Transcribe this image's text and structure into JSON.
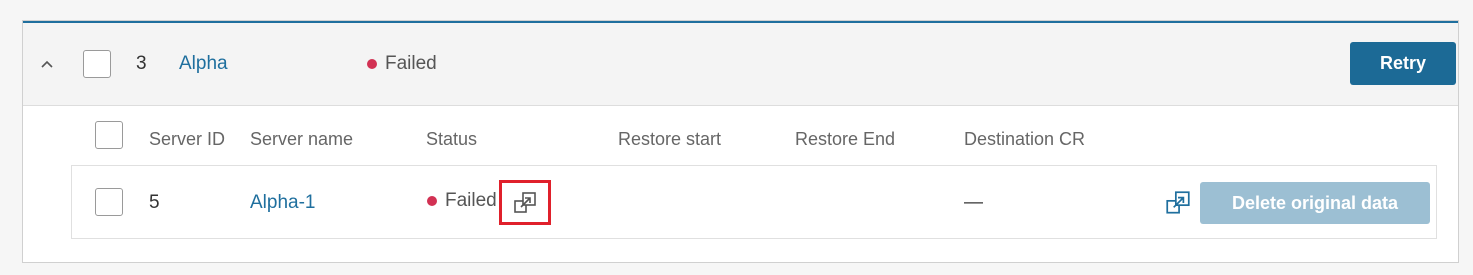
{
  "group": {
    "number": "3",
    "name": "Alpha",
    "status": "Failed",
    "retry_label": "Retry"
  },
  "columns": {
    "server_id": "Server ID",
    "server_name": "Server name",
    "status": "Status",
    "restore_start": "Restore start",
    "restore_end": "Restore End",
    "destination_cr": "Destination CR"
  },
  "rows": [
    {
      "server_id": "5",
      "server_name": "Alpha-1",
      "status": "Failed",
      "restore_start": "",
      "restore_end": "",
      "destination_cr": "—",
      "action_label": "Delete original data"
    }
  ],
  "colors": {
    "accent": "#1f6f9e",
    "primary_button": "#1c6a96",
    "disabled_button": "#9cbfd3",
    "status_failed": "#d23153",
    "highlight": "#e0202b"
  },
  "icons": {
    "collapse": "chevron-up-icon",
    "open_details": "external-link-icon"
  }
}
